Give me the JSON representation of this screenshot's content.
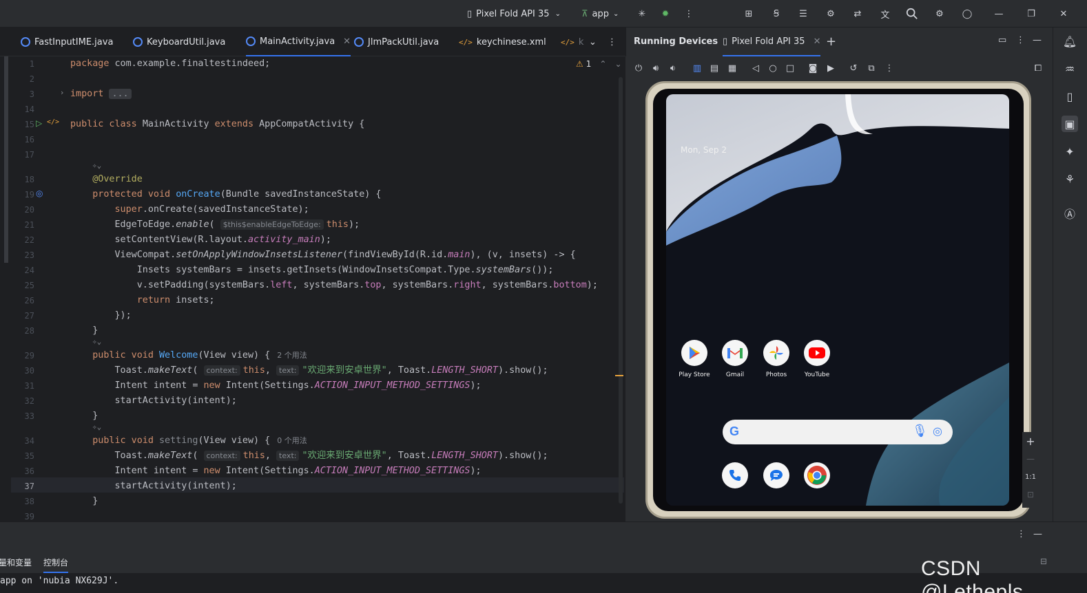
{
  "titlebar": {
    "device_selector": "Pixel Fold API 35",
    "run_config": "app"
  },
  "tabs": [
    {
      "label": "FastInputIME.java",
      "icon": "java-class-icon"
    },
    {
      "label": "KeyboardUtil.java",
      "icon": "java-class-icon"
    },
    {
      "label": "MainActivity.java",
      "icon": "java-class-icon",
      "active": true
    },
    {
      "label": "JlmPackUtil.java",
      "icon": "java-class-icon"
    },
    {
      "label": "keychinese.xml",
      "icon": "xml-icon"
    },
    {
      "label": "k",
      "icon": "xml-icon"
    }
  ],
  "editor": {
    "warnings_count": "1",
    "line_numbers": [
      "1",
      "2",
      "3",
      "14",
      "15",
      "16",
      "17",
      "18",
      "19",
      "20",
      "21",
      "22",
      "23",
      "24",
      "25",
      "26",
      "27",
      "28",
      "29",
      "30",
      "31",
      "32",
      "33",
      "34",
      "35",
      "36",
      "37",
      "38",
      "39"
    ],
    "current_line": "37",
    "hints": {
      "this_enable": "$this$enableEdgeToEdge:",
      "context": "context:",
      "text": "text:",
      "usages_welcome": "2 个用法",
      "usages_setting": "0 个用法"
    },
    "strings": {
      "package": "com.example.finaltestindeed;",
      "import_fold": "...",
      "class_name": "MainActivity",
      "super_class": "AppCompatActivity",
      "toast_text": "\"欢迎来到安卓世界\""
    }
  },
  "running_devices": {
    "title": "Running Devices",
    "device_tab": "Pixel Fold API 35",
    "screen_date": "Mon, Sep 2",
    "apps": [
      "Play Store",
      "Gmail",
      "Photos",
      "YouTube"
    ],
    "zoom_label": "1:1"
  },
  "bottom": {
    "tab_variables": "量和变量",
    "tab_console": "控制台",
    "console_line": "app on 'nubia NX629J'."
  },
  "watermark": "CSDN @Lethepls",
  "colors": {
    "accent": "#3574f0",
    "keyword": "#cf8e6d",
    "function": "#56a8f5",
    "annotation": "#b3ae60",
    "string": "#6aab73",
    "field": "#c77dbb"
  }
}
